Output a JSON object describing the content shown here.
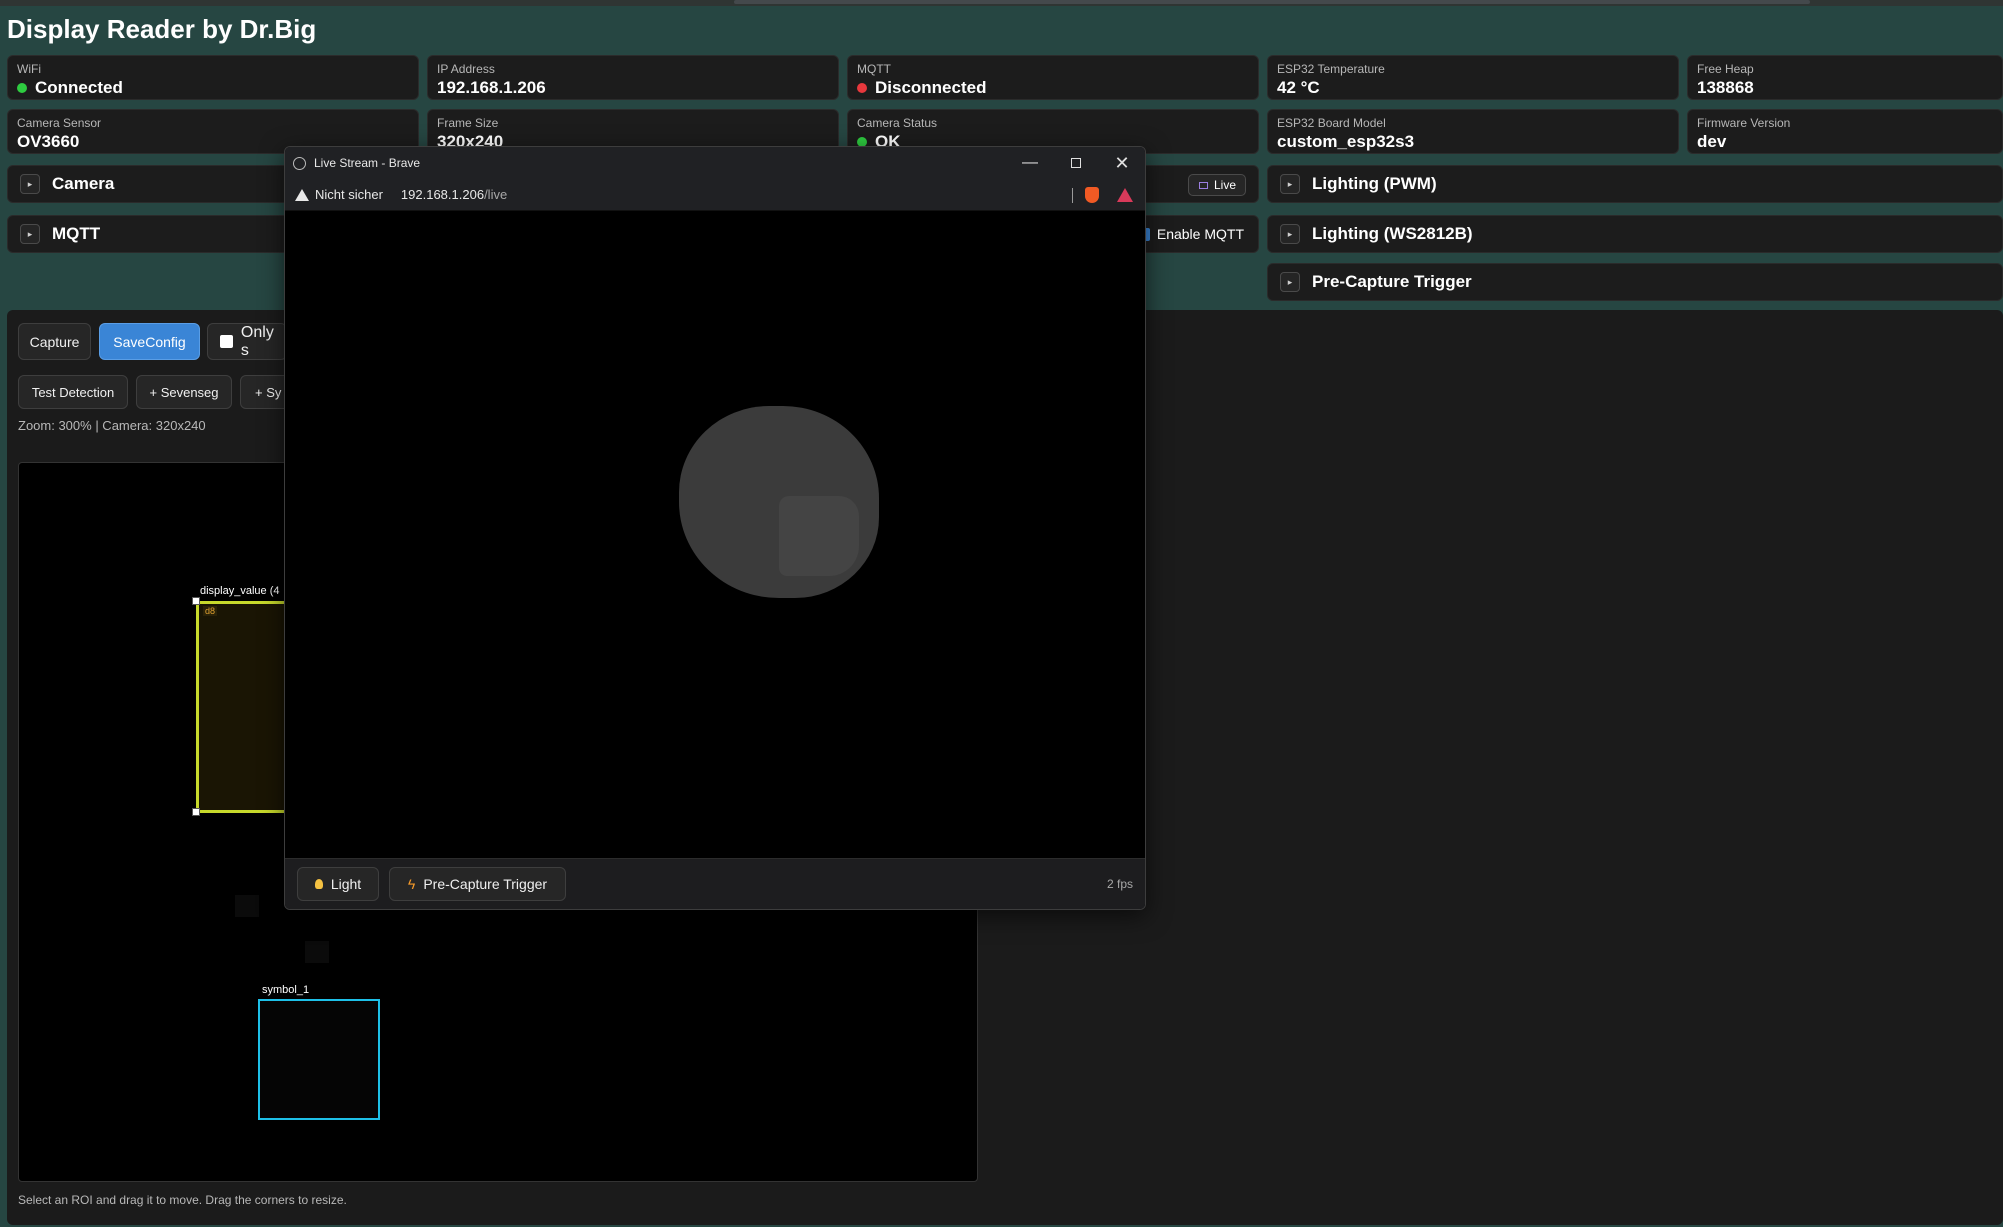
{
  "app": {
    "title": "Display Reader by Dr.Big"
  },
  "stats": {
    "wifi": {
      "label": "WiFi",
      "value": "Connected",
      "status_color": "#2ecc40"
    },
    "ip": {
      "label": "IP Address",
      "value": "192.168.1.206"
    },
    "mqtt": {
      "label": "MQTT",
      "value": "Disconnected",
      "status_color": "#e8383d"
    },
    "temp": {
      "label": "ESP32 Temperature",
      "value": "42 °C"
    },
    "heap": {
      "label": "Free Heap",
      "value": "138868"
    },
    "sensor": {
      "label": "Camera Sensor",
      "value": "OV3660"
    },
    "frame": {
      "label": "Frame Size",
      "value": "320x240"
    },
    "cam_status": {
      "label": "Camera Status",
      "value": "OK",
      "status_color": "#2ecc40"
    },
    "board": {
      "label": "ESP32 Board Model",
      "value": "custom_esp32s3"
    },
    "firmware": {
      "label": "Firmware Version",
      "value": "dev"
    }
  },
  "sections": {
    "camera": "Camera",
    "camera_live": "Live",
    "mqtt": "MQTT",
    "mqtt_enable": "Enable MQTT",
    "lighting_pwm": "Lighting (PWM)",
    "lighting_ws": "Lighting (WS2812B)",
    "precapture": "Pre-Capture Trigger"
  },
  "toolbar": {
    "capture": "Capture",
    "saveconfig": "SaveConfig",
    "only": "Only s",
    "test_detection": "Test Detection",
    "add_sevenseg": "+ Sevenseg",
    "add_sym": "+ Sy",
    "zoom_info": "Zoom: 300% | Camera: 320x240"
  },
  "canvas": {
    "roi1_label": "display_value (4",
    "roi1_digit": "d8",
    "roi2_label": "symbol_1",
    "hint": "Select an ROI and drag it to move. Drag the corners to resize."
  },
  "browser": {
    "window_title": "Live Stream - Brave",
    "security": "Nicht sicher",
    "url_host": "192.168.1.206",
    "url_path": "/live",
    "light_btn": "Light",
    "precapture_btn": "Pre-Capture Trigger",
    "fps": "2 fps"
  }
}
